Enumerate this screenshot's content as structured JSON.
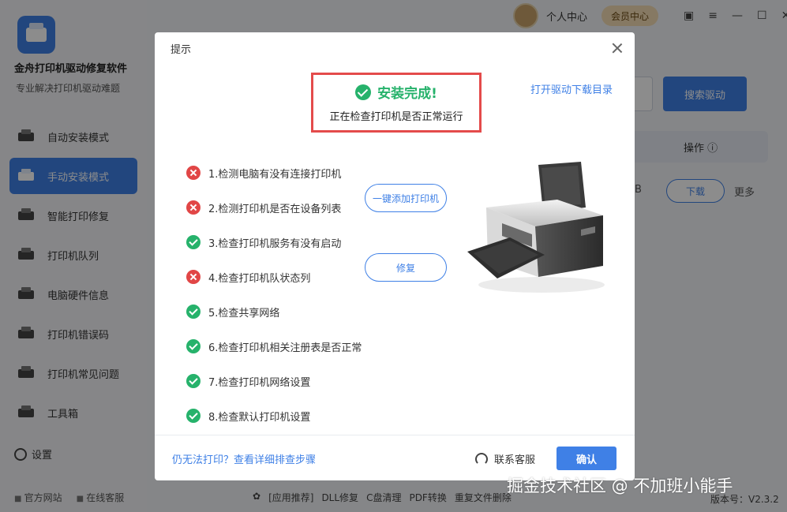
{
  "app": {
    "title": "金舟打印机驱动修复软件",
    "subtitle": "专业解决打印机驱动难题"
  },
  "sidebar": {
    "items": [
      {
        "label": "自动安装模式",
        "icon": "auto-install-icon",
        "active": false
      },
      {
        "label": "手动安装模式",
        "icon": "manual-install-icon",
        "active": true
      },
      {
        "label": "智能打印修复",
        "icon": "print-repair-icon",
        "active": false
      },
      {
        "label": "打印机队列",
        "icon": "printer-queue-icon",
        "active": false
      },
      {
        "label": "电脑硬件信息",
        "icon": "hardware-info-icon",
        "active": false
      },
      {
        "label": "打印机错误码",
        "icon": "error-code-icon",
        "active": false
      },
      {
        "label": "打印机常见问题",
        "icon": "faq-icon",
        "active": false
      },
      {
        "label": "工具箱",
        "icon": "toolbox-icon",
        "active": false
      }
    ],
    "settings_label": "设置",
    "footer": {
      "official_site": "官方网站",
      "online_service": "在线客服"
    }
  },
  "topbar": {
    "personal_center": "个人中心",
    "vip_center": "会员中心"
  },
  "main": {
    "search_button": "搜索驱动",
    "table_header_action": "操作",
    "row_fragment": "B",
    "download_button": "下载",
    "more_label": "更多"
  },
  "bottom_bar": {
    "items": [
      "[应用推荐]",
      "DLL修复",
      "C盘清理",
      "PDF转换",
      "重复文件删除"
    ],
    "version": "版本号：V2.3.2"
  },
  "dialog": {
    "title": "提示",
    "status_title": "安装完成!",
    "status_sub": "正在检查打印机是否正常运行",
    "open_dir_link": "打开驱动下载目录",
    "checks": [
      {
        "label": "1.检测电脑有没有连接打印机",
        "status": "fail"
      },
      {
        "label": "2.检测打印机是否在设备列表",
        "status": "fail"
      },
      {
        "label": "3.检查打印机服务有没有启动",
        "status": "ok"
      },
      {
        "label": "4.检查打印机队状态列",
        "status": "fail"
      },
      {
        "label": "5.检查共享网络",
        "status": "ok"
      },
      {
        "label": "6.检查打印机相关注册表是否正常",
        "status": "ok"
      },
      {
        "label": "7.检查打印机网络设置",
        "status": "ok"
      },
      {
        "label": "8.检查默认打印机设置",
        "status": "ok"
      }
    ],
    "add_printer_button": "一键添加打印机",
    "fix_button": "修复",
    "help_link": "仍无法打印？查看详细排查步骤",
    "service_label": "联系客服",
    "confirm_button": "确认"
  },
  "watermark": "掘金技术社区 @ 不加班小能手",
  "colors": {
    "accent": "#3f80e6",
    "success": "#26b26b",
    "error": "#e14646",
    "highlight_border": "#e44b4b"
  }
}
